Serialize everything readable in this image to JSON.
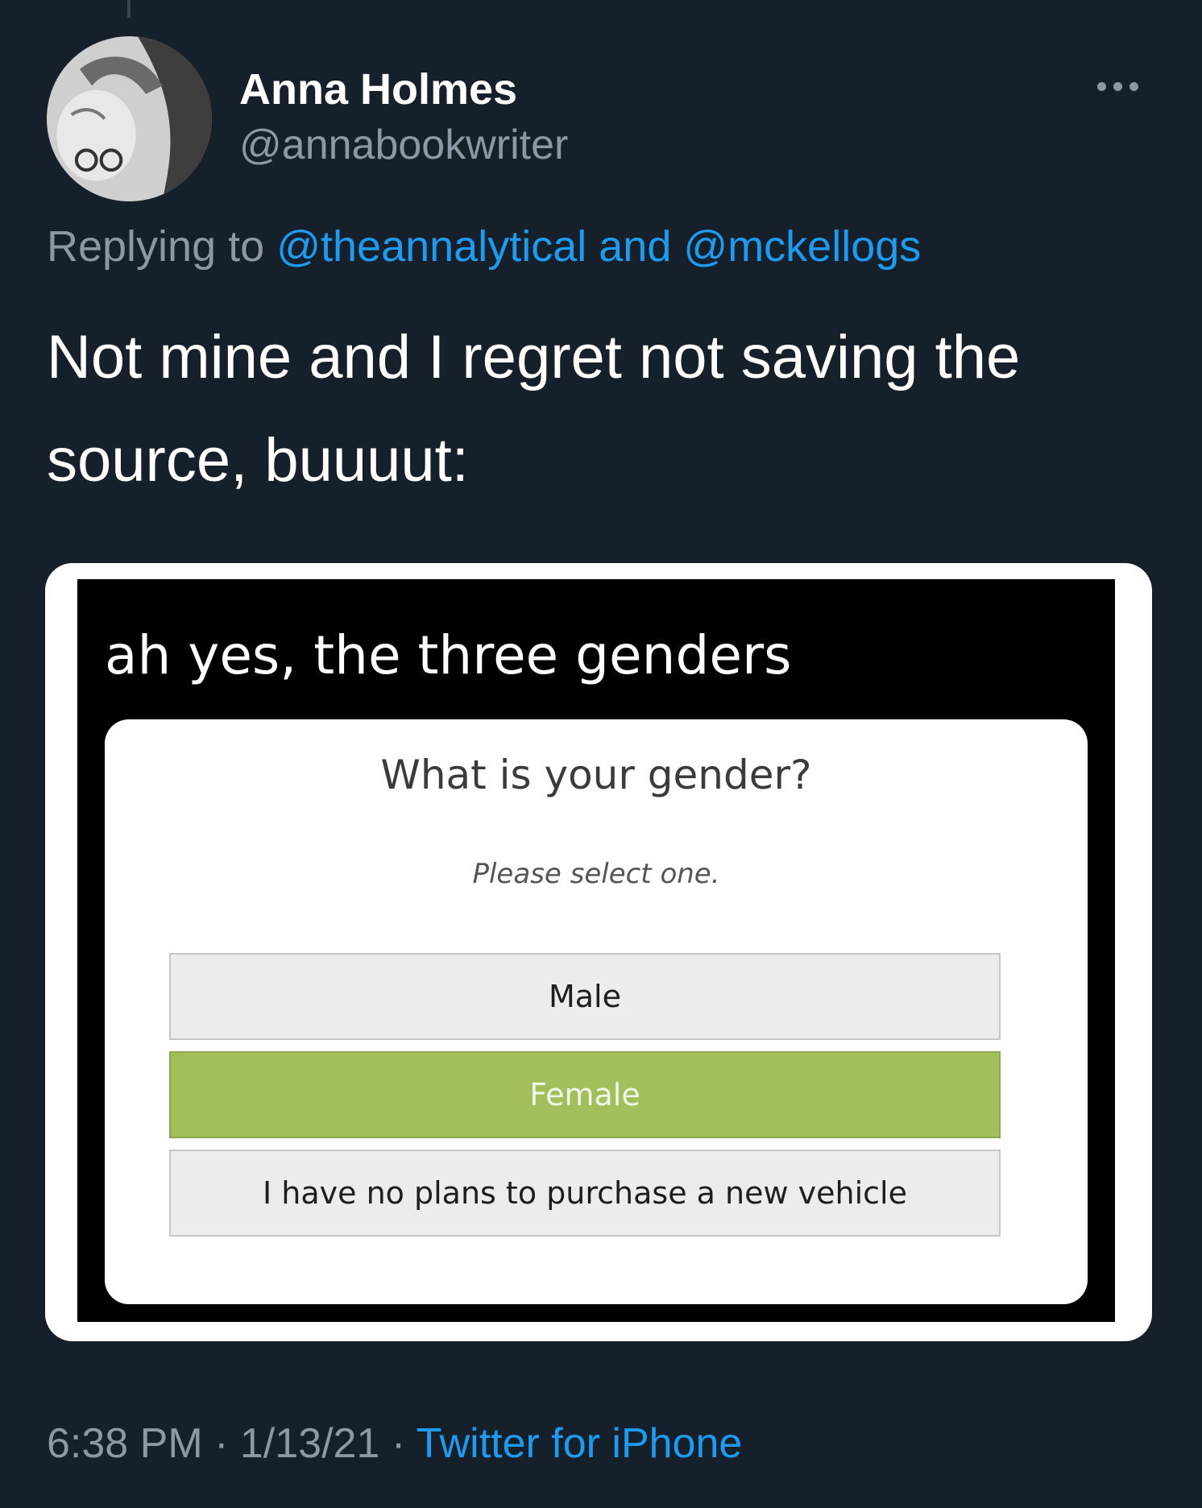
{
  "tweet": {
    "author": {
      "display_name": "Anna Holmes",
      "handle": "@annabookwriter",
      "avatar_icon": "profile-photo"
    },
    "more_icon": "more-horizontal-icon",
    "replying_to": {
      "prefix": "Replying to",
      "users": [
        "@theannalytical",
        "@mckellogs"
      ],
      "joiner": "and"
    },
    "text": "Not mine and I regret not saving the source, buuuut:",
    "timestamp": {
      "time": "6:38 PM",
      "separator": "·",
      "date": "1/13/21",
      "source": "Twitter for iPhone"
    }
  },
  "media": {
    "caption": "ah yes, the three genders",
    "survey": {
      "question": "What is your gender?",
      "hint": "Please select one.",
      "options": [
        {
          "label": "Male",
          "selected": false
        },
        {
          "label": "Female",
          "selected": true
        },
        {
          "label": "I have no plans to purchase a new vehicle",
          "selected": false
        }
      ]
    }
  },
  "colors": {
    "background": "#16202b",
    "link": "#1d9bf0",
    "secondary_text": "#8b98a5",
    "selected_option": "#a2bf5b"
  }
}
